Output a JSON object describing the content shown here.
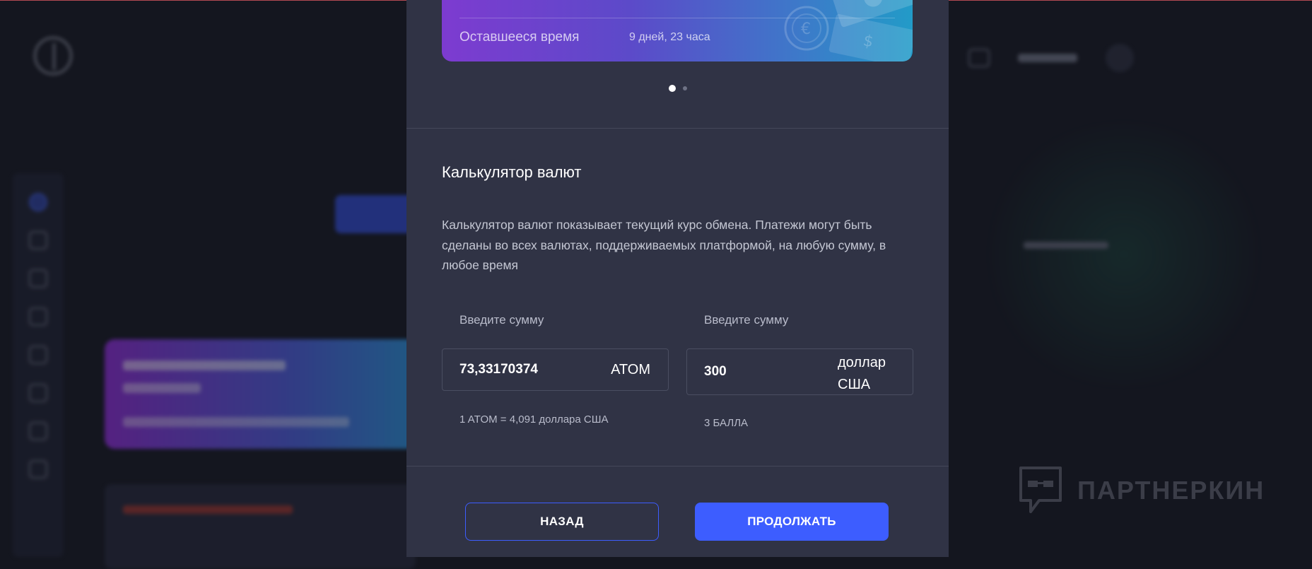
{
  "background": {
    "watermark_text": "ПАРТНЕРКИН"
  },
  "modal": {
    "timer_card": {
      "time_label": "Оставшееся время",
      "time_value": "9 дней, 23 часа"
    },
    "carousel": {
      "total": 2,
      "active_index": 0
    },
    "calculator": {
      "title": "Калькулятор валют",
      "description": "Калькулятор валют показывает текущий курс обмена. Платежи могут быть сделаны во всех валютах, поддерживаемых платформой, на любую сумму, в любое время",
      "left_field": {
        "label": "Введите сумму",
        "value": "73,33170374",
        "unit": "ATOM",
        "note": "1 ATOM = 4,091 доллара США"
      },
      "right_field": {
        "label": "Введите сумму",
        "value": "300",
        "unit": "доллар США",
        "note": "3 БАЛЛА"
      }
    },
    "buttons": {
      "back_label": "НАЗАД",
      "continue_label": "ПРОДОЛЖАТЬ"
    }
  },
  "colors": {
    "modal_bg": "#303345",
    "accent": "#3d5dff",
    "card_gradient_start": "#7d3bd0",
    "card_gradient_end": "#229bc8"
  }
}
